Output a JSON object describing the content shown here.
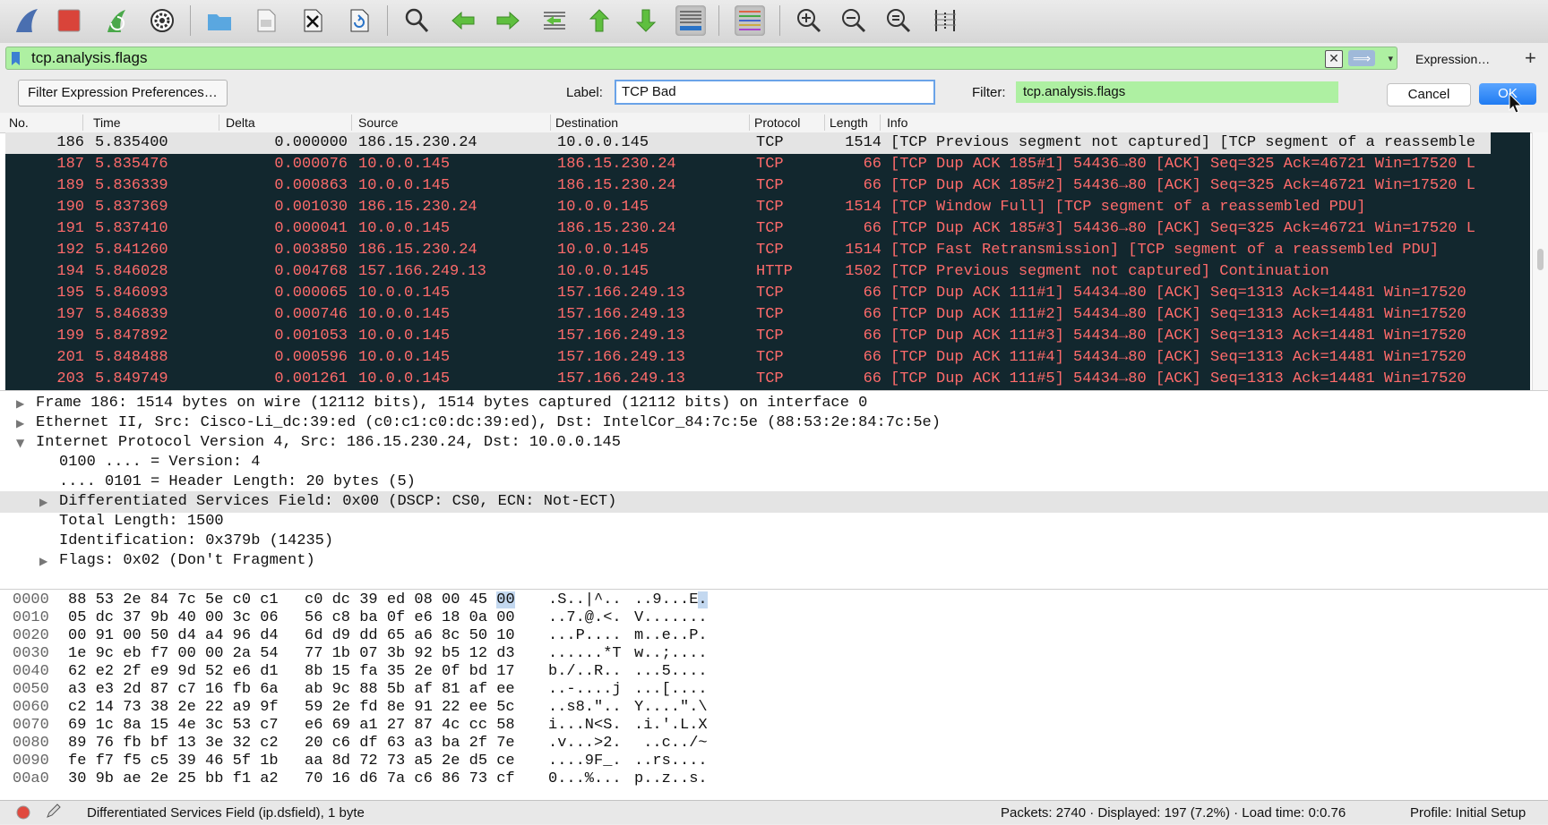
{
  "toolbar": {
    "icons": [
      "shark-fin-start-icon",
      "stop-icon",
      "restart-icon",
      "capture-options-icon",
      "open-folder-icon",
      "save-file-icon",
      "close-file-icon",
      "reload-icon",
      "find-icon",
      "go-back-icon",
      "go-forward-icon",
      "go-to-packet-icon",
      "first-packet-icon",
      "last-packet-icon",
      "autoscroll-icon",
      "colorize-icon",
      "zoom-in-icon",
      "zoom-out-icon",
      "normal-size-icon",
      "resize-columns-icon"
    ]
  },
  "filter": {
    "value": "tcp.analysis.flags",
    "clear_glyph": "✕",
    "apply_glyph": "⟹",
    "dropdown_glyph": "▾",
    "expression_label": "Expression…",
    "add_glyph": "+"
  },
  "label_bar": {
    "prefs_button": "Filter Expression Preferences…",
    "label_caption": "Label:",
    "label_value": "TCP Bad",
    "filter_caption": "Filter:",
    "filter_value": "tcp.analysis.flags",
    "cancel_label": "Cancel",
    "ok_label": "OK"
  },
  "packet_list": {
    "columns": [
      "No.",
      "Time",
      "Delta",
      "Source",
      "Destination",
      "Protocol",
      "Length",
      "Info"
    ],
    "rows": [
      {
        "no": "186",
        "time": "5.835400",
        "delta": "0.000000",
        "src": "186.15.230.24",
        "dst": "10.0.0.145",
        "proto": "TCP",
        "len": "1514",
        "info": "[TCP Previous segment not captured] [TCP segment of a reassemble"
      },
      {
        "no": "187",
        "time": "5.835476",
        "delta": "0.000076",
        "src": "10.0.0.145",
        "dst": "186.15.230.24",
        "proto": "TCP",
        "len": "66",
        "info": "[TCP Dup ACK 185#1] 54436→80 [ACK] Seq=325 Ack=46721 Win=17520 L"
      },
      {
        "no": "189",
        "time": "5.836339",
        "delta": "0.000863",
        "src": "10.0.0.145",
        "dst": "186.15.230.24",
        "proto": "TCP",
        "len": "66",
        "info": "[TCP Dup ACK 185#2] 54436→80 [ACK] Seq=325 Ack=46721 Win=17520 L"
      },
      {
        "no": "190",
        "time": "5.837369",
        "delta": "0.001030",
        "src": "186.15.230.24",
        "dst": "10.0.0.145",
        "proto": "TCP",
        "len": "1514",
        "info": "[TCP Window Full] [TCP segment of a reassembled PDU]"
      },
      {
        "no": "191",
        "time": "5.837410",
        "delta": "0.000041",
        "src": "10.0.0.145",
        "dst": "186.15.230.24",
        "proto": "TCP",
        "len": "66",
        "info": "[TCP Dup ACK 185#3] 54436→80 [ACK] Seq=325 Ack=46721 Win=17520 L"
      },
      {
        "no": "192",
        "time": "5.841260",
        "delta": "0.003850",
        "src": "186.15.230.24",
        "dst": "10.0.0.145",
        "proto": "TCP",
        "len": "1514",
        "info": "[TCP Fast Retransmission] [TCP segment of a reassembled PDU]"
      },
      {
        "no": "194",
        "time": "5.846028",
        "delta": "0.004768",
        "src": "157.166.249.13",
        "dst": "10.0.0.145",
        "proto": "HTTP",
        "len": "1502",
        "info": "[TCP Previous segment not captured] Continuation"
      },
      {
        "no": "195",
        "time": "5.846093",
        "delta": "0.000065",
        "src": "10.0.0.145",
        "dst": "157.166.249.13",
        "proto": "TCP",
        "len": "66",
        "info": "[TCP Dup ACK 111#1] 54434→80 [ACK] Seq=1313 Ack=14481 Win=17520"
      },
      {
        "no": "197",
        "time": "5.846839",
        "delta": "0.000746",
        "src": "10.0.0.145",
        "dst": "157.166.249.13",
        "proto": "TCP",
        "len": "66",
        "info": "[TCP Dup ACK 111#2] 54434→80 [ACK] Seq=1313 Ack=14481 Win=17520"
      },
      {
        "no": "199",
        "time": "5.847892",
        "delta": "0.001053",
        "src": "10.0.0.145",
        "dst": "157.166.249.13",
        "proto": "TCP",
        "len": "66",
        "info": "[TCP Dup ACK 111#3] 54434→80 [ACK] Seq=1313 Ack=14481 Win=17520"
      },
      {
        "no": "201",
        "time": "5.848488",
        "delta": "0.000596",
        "src": "10.0.0.145",
        "dst": "157.166.249.13",
        "proto": "TCP",
        "len": "66",
        "info": "[TCP Dup ACK 111#4] 54434→80 [ACK] Seq=1313 Ack=14481 Win=17520"
      },
      {
        "no": "203",
        "time": "5.849749",
        "delta": "0.001261",
        "src": "10.0.0.145",
        "dst": "157.166.249.13",
        "proto": "TCP",
        "len": "66",
        "info": "[TCP Dup ACK 111#5] 54434→80 [ACK] Seq=1313 Ack=14481 Win=17520"
      }
    ]
  },
  "details": {
    "lines": [
      {
        "arrow": "▶",
        "text": "Frame 186: 1514 bytes on wire (12112 bits), 1514 bytes captured (12112 bits) on interface 0"
      },
      {
        "arrow": "▶",
        "text": "Ethernet II, Src: Cisco-Li_dc:39:ed (c0:c1:c0:dc:39:ed), Dst: IntelCor_84:7c:5e (88:53:2e:84:7c:5e)"
      },
      {
        "arrow": "▼",
        "text": "Internet Protocol Version 4, Src: 186.15.230.24, Dst: 10.0.0.145"
      },
      {
        "arrow": "",
        "text": "0100 .... = Version: 4"
      },
      {
        "arrow": "",
        "text": ".... 0101 = Header Length: 20 bytes (5)"
      },
      {
        "arrow": "▶",
        "text": "Differentiated Services Field: 0x00 (DSCP: CS0, ECN: Not-ECT)"
      },
      {
        "arrow": "",
        "text": "Total Length: 1500"
      },
      {
        "arrow": "",
        "text": "Identification: 0x379b (14235)"
      },
      {
        "arrow": "▶",
        "text": "Flags: 0x02 (Don't Fragment)"
      }
    ]
  },
  "bytes": {
    "rows": [
      {
        "off": "0000",
        "h1": "88 53 2e 84 7c 5e c0 c1",
        "h2a": "c0 dc 39 ed 08 00 45 ",
        "h2hl": "00",
        "a1": ".S..|^..",
        "a2a": "..9...E",
        "a2hl": "."
      },
      {
        "off": "0010",
        "h1a": "05 dc 37 9b 40 00 3c 06",
        "h1hl": "",
        "h2": "56 c8 ba 0f e6 18 0a 00",
        "a1": "..7.@.<.",
        "a2": "V.......",
        "hl_start": true
      },
      {
        "off": "0020",
        "h1": "00 91 00 50 d4 a4 96 d4",
        "h2": "6d d9 dd 65 a6 8c 50 10",
        "a1": "...P....",
        "a2": "m..e..P."
      },
      {
        "off": "0030",
        "h1": "1e 9c eb f7 00 00 2a 54",
        "h2": "77 1b 07 3b 92 b5 12 d3",
        "a1": "......*T",
        "a2": "w..;...."
      },
      {
        "off": "0040",
        "h1": "62 e2 2f e9 9d 52 e6 d1",
        "h2": "8b 15 fa 35 2e 0f bd 17",
        "a1": "b./..R..",
        "a2": "...5...."
      },
      {
        "off": "0050",
        "h1": "a3 e3 2d 87 c7 16 fb 6a",
        "h2": "ab 9c 88 5b af 81 af ee",
        "a1": "..-....j",
        "a2": "...[...."
      },
      {
        "off": "0060",
        "h1": "c2 14 73 38 2e 22 a9 9f",
        "h2": "59 2e fd 8e 91 22 ee 5c",
        "a1": "..s8.\"..",
        "a2": "Y....\".\\"
      },
      {
        "off": "0070",
        "h1": "69 1c 8a 15 4e 3c 53 c7",
        "h2": "e6 69 a1 27 87 4c cc 58",
        "a1": "i...N<S.",
        "a2": ".i.'.L.X"
      },
      {
        "off": "0080",
        "h1": "89 76 fb bf 13 3e 32 c2",
        "h2": "20 c6 df 63 a3 ba 2f 7e",
        "a1": ".v...>2.",
        "a2": " ..c../~"
      },
      {
        "off": "0090",
        "h1": "fe f7 f5 c5 39 46 5f 1b",
        "h2": "aa 8d 72 73 a5 2e d5 ce",
        "a1": "....9F_.",
        "a2": "..rs...."
      },
      {
        "off": "00a0",
        "h1": "30 9b ae 2e 25 bb f1 a2",
        "h2": "70 16 d6 7a c6 86 73 cf",
        "a1": "0...%...",
        "a2": "p..z..s."
      }
    ]
  },
  "status": {
    "field_info": "Differentiated Services Field (ip.dsfield), 1 byte",
    "stats": "Packets: 2740 · Displayed: 197 (7.2%) · Load time: 0:0.76",
    "profile": "Profile: Initial Setup"
  },
  "colors": {
    "bad_row_bg": "#12272e",
    "bad_row_fg": "#ff6b6b",
    "filter_green": "#aef0a2",
    "accent_blue": "#1f7bf2"
  }
}
